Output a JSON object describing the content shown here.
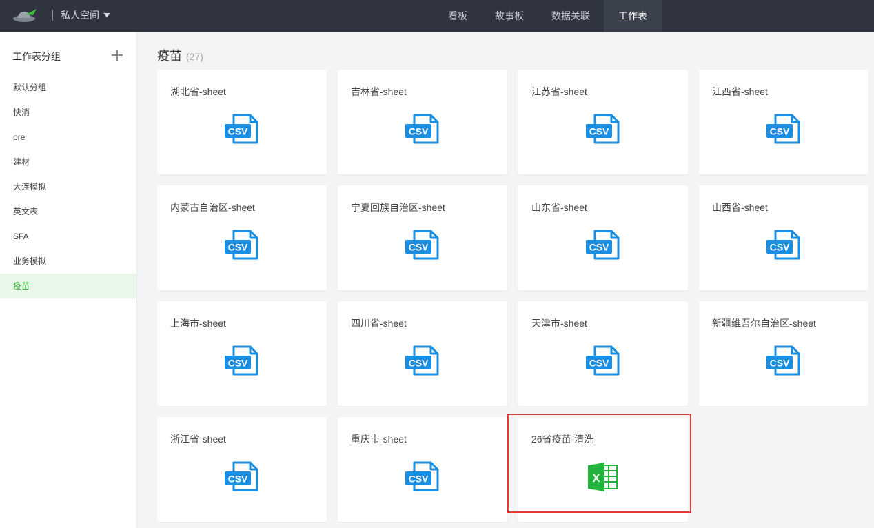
{
  "header": {
    "space_name": "私人空间",
    "nav": [
      {
        "label": "看板"
      },
      {
        "label": "故事板"
      },
      {
        "label": "数据关联"
      },
      {
        "label": "工作表"
      }
    ],
    "active_nav": "工作表"
  },
  "sidebar": {
    "title": "工作表分组",
    "groups": [
      {
        "label": "默认分组"
      },
      {
        "label": "快消"
      },
      {
        "label": "pre"
      },
      {
        "label": "建材"
      },
      {
        "label": "大连模拟"
      },
      {
        "label": "英文表"
      },
      {
        "label": "SFA"
      },
      {
        "label": "业务模拟"
      },
      {
        "label": "疫苗"
      }
    ],
    "active_group": "疫苗"
  },
  "main": {
    "group_title": "疫苗",
    "group_count": "(27)",
    "sheets": [
      {
        "name": "湖北省-sheet",
        "type": "csv"
      },
      {
        "name": "吉林省-sheet",
        "type": "csv"
      },
      {
        "name": "江苏省-sheet",
        "type": "csv"
      },
      {
        "name": "江西省-sheet",
        "type": "csv"
      },
      {
        "name": "内蒙古自治区-sheet",
        "type": "csv"
      },
      {
        "name": "宁夏回族自治区-sheet",
        "type": "csv"
      },
      {
        "name": "山东省-sheet",
        "type": "csv"
      },
      {
        "name": "山西省-sheet",
        "type": "csv"
      },
      {
        "name": "上海市-sheet",
        "type": "csv"
      },
      {
        "name": "四川省-sheet",
        "type": "csv"
      },
      {
        "name": "天津市-sheet",
        "type": "csv"
      },
      {
        "name": "新疆维吾尔自治区-sheet",
        "type": "csv"
      },
      {
        "name": "浙江省-sheet",
        "type": "csv"
      },
      {
        "name": "重庆市-sheet",
        "type": "csv"
      },
      {
        "name": "26省疫苗-清洗",
        "type": "excel"
      }
    ]
  },
  "colors": {
    "topbar": "#2f3440",
    "accent_green": "#23a325",
    "csv_blue": "#1a8ee1",
    "excel_green": "#21b33b",
    "highlight_red": "#e53935"
  },
  "icons": {
    "csv": "csv-file-icon",
    "excel": "excel-file-icon"
  }
}
